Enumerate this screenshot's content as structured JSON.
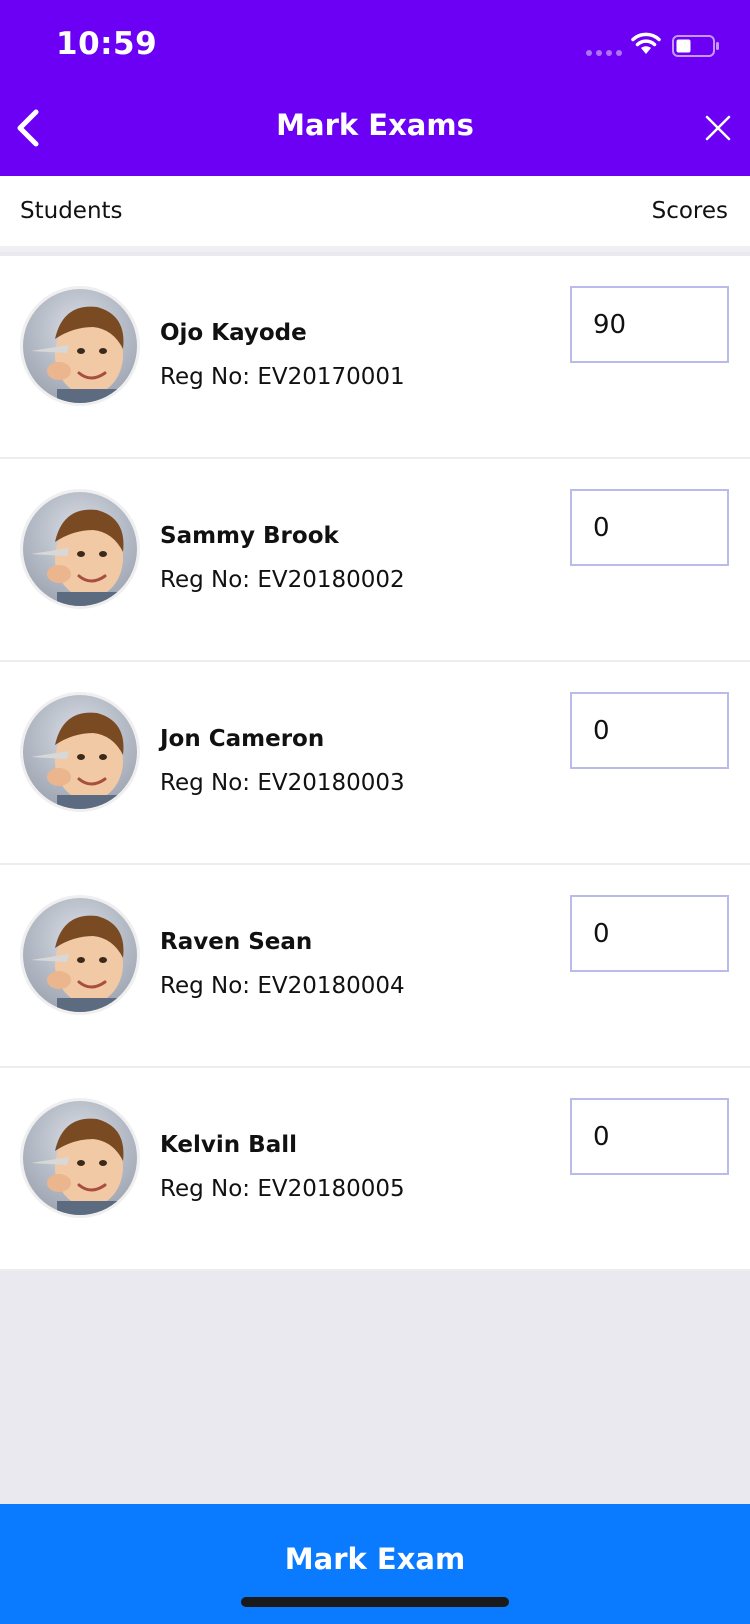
{
  "status_bar": {
    "time": "10:59"
  },
  "nav": {
    "title": "Mark Exams",
    "back_icon": "chevron-left-icon",
    "close_icon": "close-icon"
  },
  "columns": {
    "students": "Students",
    "scores": "Scores"
  },
  "students": [
    {
      "name": "Ojo Kayode",
      "reg": "Reg No: EV20170001",
      "score": "90"
    },
    {
      "name": "Sammy Brook",
      "reg": "Reg No: EV20180002",
      "score": "0"
    },
    {
      "name": "Jon Cameron",
      "reg": "Reg No: EV20180003",
      "score": "0"
    },
    {
      "name": "Raven Sean",
      "reg": "Reg No: EV20180004",
      "score": "0"
    },
    {
      "name": "Kelvin Ball",
      "reg": "Reg No: EV20180005",
      "score": "0"
    }
  ],
  "footer": {
    "button_label": "Mark Exam"
  },
  "colors": {
    "header": "#6B00F5",
    "footer": "#0A7AFE",
    "input_border": "#B9BCEB"
  }
}
